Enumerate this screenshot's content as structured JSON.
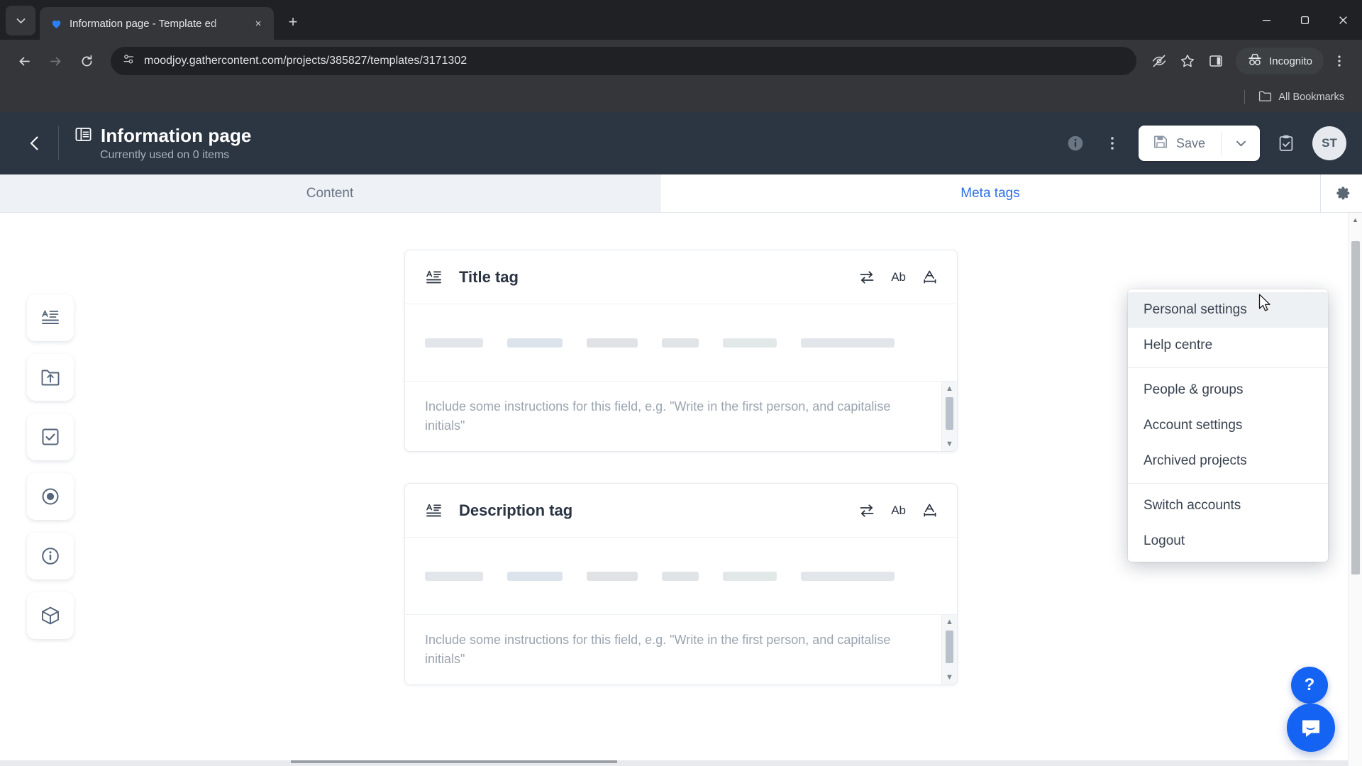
{
  "browser": {
    "tab": {
      "title": "Information page - Template ed",
      "favicon": "gathercontent-heart-icon",
      "close_label": "×"
    },
    "new_tab_label": "+",
    "tab_list_label": "⌄",
    "window_controls": {
      "minimize": "—",
      "maximize": "❐",
      "close": "✕"
    },
    "url": "moodjoy.gathercontent.com/projects/385827/templates/3171302",
    "nav": {
      "back": "←",
      "forward": "→",
      "reload": "↻"
    },
    "incognito_label": "Incognito",
    "bookmarks": {
      "all_label": "All Bookmarks"
    }
  },
  "app": {
    "header": {
      "back_label": "‹",
      "title": "Information page",
      "subtitle": "Currently used on 0 items",
      "info_label": "i",
      "more_label": "⋮",
      "save_label": "Save",
      "save_caret_label": "∨",
      "avatar_initials": "ST"
    },
    "tabs": [
      {
        "label": "Content",
        "active": false
      },
      {
        "label": "Meta tags",
        "active": true
      }
    ],
    "settings_gear_label": "gear-icon",
    "left_rail": [
      {
        "name": "text-field-icon",
        "label": "Text field"
      },
      {
        "name": "file-upload-icon",
        "label": "File upload"
      },
      {
        "name": "checkbox-icon",
        "label": "Checkboxes"
      },
      {
        "name": "radio-icon",
        "label": "Radio buttons"
      },
      {
        "name": "guidelines-icon",
        "label": "Guidelines"
      },
      {
        "name": "component-icon",
        "label": "Component"
      }
    ],
    "cards": [
      {
        "title": "Title tag",
        "field_icon": "text-field-icon",
        "tools": {
          "repeat": "repeat-icon",
          "ab": "Ab",
          "length": "text-length-icon"
        },
        "skeleton_widths": [
          82,
          78,
          72,
          52,
          76,
          132
        ],
        "instructions_placeholder": "Include some instructions for this field, e.g. \"Write in the first person, and capitalise initials\""
      },
      {
        "title": "Description tag",
        "field_icon": "text-field-icon",
        "tools": {
          "repeat": "repeat-icon",
          "ab": "Ab",
          "length": "text-length-icon"
        },
        "skeleton_widths": [
          82,
          78,
          72,
          52,
          76,
          132
        ],
        "instructions_placeholder": "Include some instructions for this field, e.g. \"Write in the first person, and capitalise initials\""
      }
    ],
    "dropdown": {
      "groups": [
        [
          {
            "label": "Personal settings",
            "highlighted": true
          },
          {
            "label": "Help centre",
            "highlighted": false
          }
        ],
        [
          {
            "label": "People & groups",
            "highlighted": false
          },
          {
            "label": "Account settings",
            "highlighted": false
          },
          {
            "label": "Archived projects",
            "highlighted": false
          }
        ],
        [
          {
            "label": "Switch accounts",
            "highlighted": false
          },
          {
            "label": "Logout",
            "highlighted": false
          }
        ]
      ]
    },
    "floating": {
      "help_label": "?",
      "intercom_label": "intercom-chat-icon"
    }
  },
  "colors": {
    "header_bg": "#2c3642",
    "accent_blue": "#2f6fe4",
    "intercom_blue": "#1463f3",
    "chrome_dark": "#202124",
    "chrome_toolbar": "#35363a"
  }
}
